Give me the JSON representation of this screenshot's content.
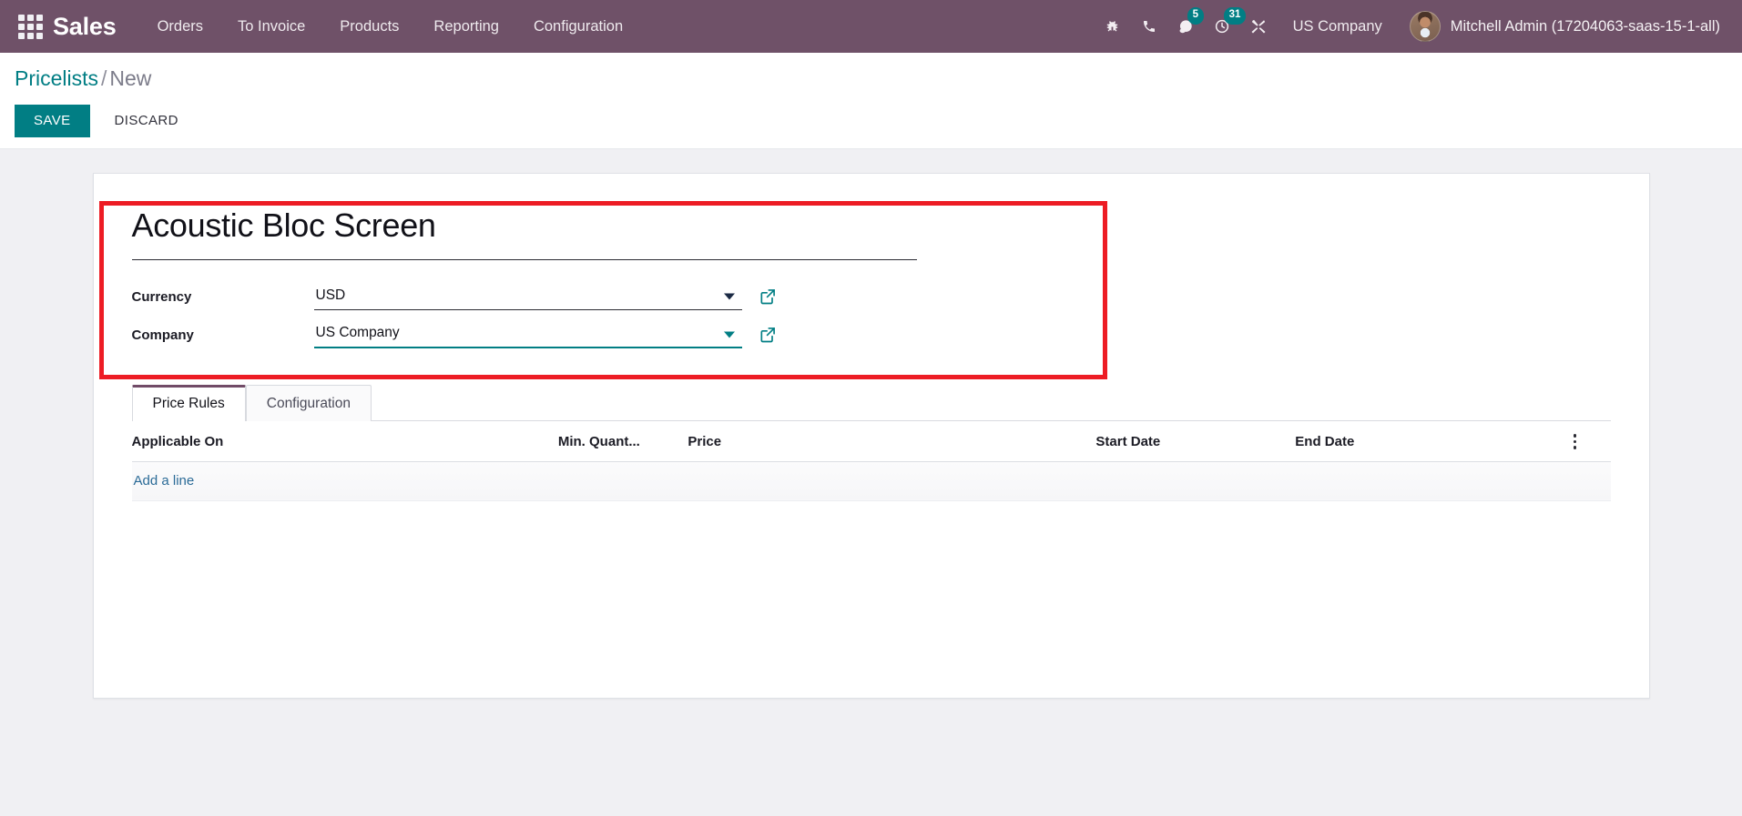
{
  "navbar": {
    "apps_icon": "apps-grid-icon",
    "brand": "Sales",
    "menu": [
      {
        "label": "Orders"
      },
      {
        "label": "To Invoice"
      },
      {
        "label": "Products"
      },
      {
        "label": "Reporting"
      },
      {
        "label": "Configuration"
      }
    ],
    "sys_icons": [
      {
        "name": "bug-icon",
        "badge": ""
      },
      {
        "name": "phone-icon",
        "badge": ""
      },
      {
        "name": "messages-icon",
        "badge": "5"
      },
      {
        "name": "activities-icon",
        "badge": "31"
      },
      {
        "name": "tools-icon",
        "badge": ""
      }
    ],
    "company": "US Company",
    "user": "Mitchell Admin (17204063-saas-15-1-all)",
    "avatar_name": "user-avatar",
    "background_color": "#6f5168",
    "badge_color": "#017e84"
  },
  "control_panel": {
    "breadcrumb_root": "Pricelists",
    "breadcrumb_sep": "/",
    "breadcrumb_current": "New",
    "save_label": "SAVE",
    "discard_label": "DISCARD",
    "save_color": "#017e84"
  },
  "form": {
    "title": "Acoustic Bloc Screen",
    "title_placeholder": "e.g. USD Retailers",
    "fields": [
      {
        "label": "Currency",
        "value": "USD",
        "focused": false,
        "dropdown_icon": "chevron-down-icon",
        "external_icon": "external-link-icon"
      },
      {
        "label": "Company",
        "value": "US Company",
        "focused": true,
        "dropdown_icon": "chevron-down-icon",
        "external_icon": "external-link-icon"
      }
    ],
    "highlight_color": "#ed1c24"
  },
  "notebook": {
    "tabs": [
      {
        "label": "Price Rules",
        "active": true
      },
      {
        "label": "Configuration",
        "active": false
      }
    ],
    "active_tab_color": "#714b67"
  },
  "price_rules": {
    "columns": [
      "Applicable On",
      "Min. Quant...",
      "Price",
      "Start Date",
      "End Date"
    ],
    "rows": [],
    "add_line_label": "Add a line",
    "options_icon": "vertical-dots-icon"
  }
}
